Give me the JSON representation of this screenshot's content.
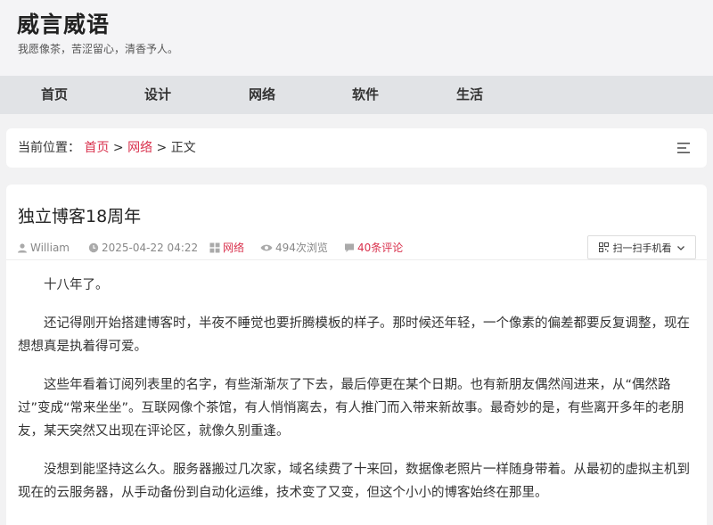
{
  "site": {
    "title": "威言威语",
    "tagline": "我愿像茶，苦涩留心，清香予人。"
  },
  "nav": {
    "items": [
      {
        "label": "首页"
      },
      {
        "label": "设计"
      },
      {
        "label": "网络"
      },
      {
        "label": "软件"
      },
      {
        "label": "生活"
      }
    ]
  },
  "breadcrumb": {
    "prefix": "当前位置：",
    "home": "首页",
    "sep": ">",
    "category": "网络",
    "current": "正文"
  },
  "article": {
    "title": "独立博客18周年",
    "meta": {
      "author": "William",
      "datetime": "2025-04-22 04:22",
      "category": "网络",
      "views": "494次浏览",
      "comments": "40条评论"
    },
    "qr_label": "扫一扫手机看",
    "paragraphs": [
      "十八年了。",
      "还记得刚开始搭建博客时，半夜不睡觉也要折腾模板的样子。那时候还年轻，一个像素的偏差都要反复调整，现在想想真是执着得可爱。",
      "这些年看着订阅列表里的名字，有些渐渐灰了下去，最后停更在某个日期。也有新朋友偶然闯进来，从“偶然路过”变成“常来坐坐”。互联网像个茶馆，有人悄悄离去，有人推门而入带来新故事。最奇妙的是，有些离开多年的老朋友，某天突然又出现在评论区，就像久别重逢。",
      "没想到能坚持这么久。服务器搬过几次家，域名续费了十来回，数据像老照片一样随身带着。从最初的虚拟主机到现在的云服务器，从手动备份到自动化运维，技术变了又变，但这个小小的博客始终在那里。"
    ]
  },
  "colors": {
    "accent": "#d9314d",
    "nav_bg": "#e1e3e6",
    "page_bg": "#f2f2f3"
  },
  "icons": [
    "user-icon",
    "clock-icon",
    "grid-icon",
    "eye-icon",
    "comment-icon",
    "qrcode-icon",
    "chevron-down-icon",
    "menu-icon"
  ]
}
